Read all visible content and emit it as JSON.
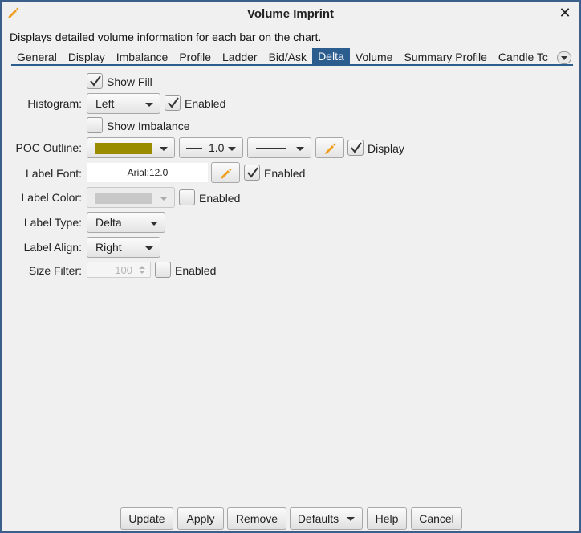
{
  "window": {
    "title": "Volume Imprint",
    "description": "Displays detailed volume information for each bar on the chart."
  },
  "tabs": [
    {
      "label": "General"
    },
    {
      "label": "Display"
    },
    {
      "label": "Imbalance"
    },
    {
      "label": "Profile"
    },
    {
      "label": "Ladder"
    },
    {
      "label": "Bid/Ask"
    },
    {
      "label": "Delta",
      "active": true
    },
    {
      "label": "Volume"
    },
    {
      "label": "Summary Profile"
    },
    {
      "label": "Candle Tc"
    }
  ],
  "form": {
    "show_fill": {
      "label": "Show Fill",
      "checked": true
    },
    "histogram": {
      "label": "Histogram:",
      "value": "Left",
      "enabled_label": "Enabled",
      "enabled": true
    },
    "show_imbalance": {
      "label": "Show Imbalance",
      "checked": false
    },
    "poc_outline": {
      "label": "POC Outline:",
      "color": "#9a8c00",
      "width": "1.0",
      "display_label": "Display",
      "display": true
    },
    "label_font": {
      "label": "Label Font:",
      "value": "Arial;12.0",
      "enabled_label": "Enabled",
      "enabled": true
    },
    "label_color": {
      "label": "Label Color:",
      "color": "#c8c8c8",
      "enabled_label": "Enabled",
      "enabled": false
    },
    "label_type": {
      "label": "Label Type:",
      "value": "Delta"
    },
    "label_align": {
      "label": "Label Align:",
      "value": "Right"
    },
    "size_filter": {
      "label": "Size Filter:",
      "value": "100",
      "enabled_label": "Enabled",
      "enabled": false
    }
  },
  "buttons": {
    "update": "Update",
    "apply": "Apply",
    "remove": "Remove",
    "defaults": "Defaults",
    "help": "Help",
    "cancel": "Cancel"
  },
  "colors": {
    "accent": "#2b5d8f",
    "pencil": "#f0a020"
  }
}
